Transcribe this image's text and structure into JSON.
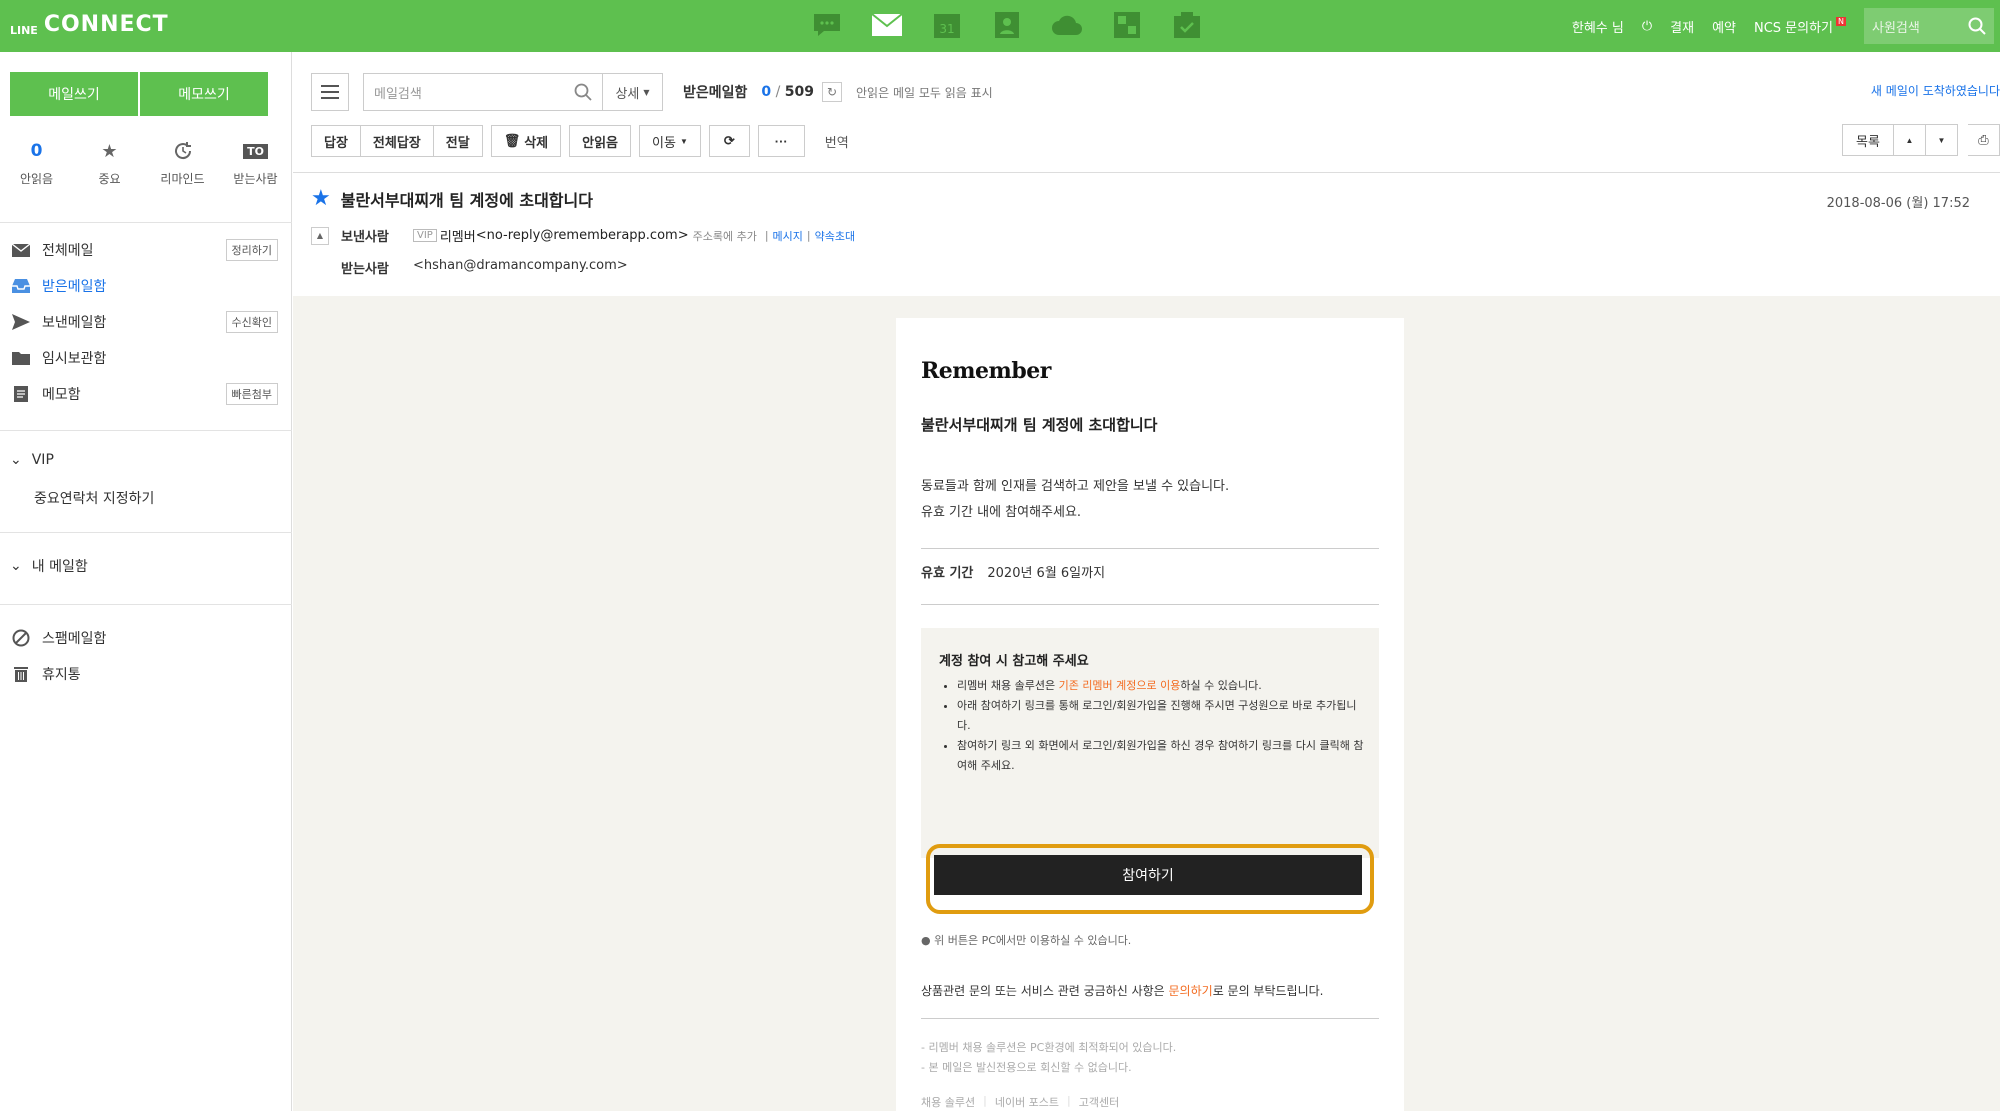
{
  "header": {
    "logo_small": "LINE",
    "logo_big": "CONNECT",
    "apps": [
      {
        "icon": "chat-icon"
      },
      {
        "icon": "mail-icon"
      },
      {
        "icon": "calendar-icon",
        "label": "31"
      },
      {
        "icon": "contacts-icon"
      },
      {
        "icon": "cloud-icon"
      },
      {
        "icon": "board-icon"
      },
      {
        "icon": "task-icon"
      }
    ],
    "user": "한혜수 님",
    "links": [
      "결재",
      "예약",
      "NCS 문의하기"
    ],
    "new_badge": "N",
    "employee_search_placeholder": "사원검색"
  },
  "sidebar": {
    "write_mail": "메일쓰기",
    "write_memo": "메모쓰기",
    "quick": [
      {
        "label": "안읽음",
        "count": "0"
      },
      {
        "label": "중요",
        "icon": "star-icon"
      },
      {
        "label": "리마인드",
        "icon": "remind-icon"
      },
      {
        "label": "받는사람",
        "badge": "TO"
      }
    ],
    "folders": [
      {
        "label": "전체메일",
        "button": "정리하기"
      },
      {
        "label": "받은메일함"
      },
      {
        "label": "보낸메일함",
        "button": "수신확인"
      },
      {
        "label": "임시보관함"
      },
      {
        "label": "메모함",
        "button": "빠른첨부"
      }
    ],
    "vip_label": "VIP",
    "vip_sub": "중요연락처 지정하기",
    "my_mailbox": "내 메일함",
    "spam": "스팸메일함",
    "trash": "휴지통"
  },
  "toolbar": {
    "search_placeholder": "메일검색",
    "detail": "상세",
    "inbox_title": "받은메일함",
    "unread": "0",
    "total": "509",
    "mark_all_read": "안읽은 메일 모두 읽음 표시",
    "new_mail_notice": "새 메일이 도착하였습니다",
    "reply": "답장",
    "reply_all": "전체답장",
    "forward": "전달",
    "delete": "삭제",
    "mark_unread": "안읽음",
    "move": "이동",
    "more": "···",
    "translate": "번역",
    "list": "목록"
  },
  "mail": {
    "subject": "불란서부대찌개 팀 계정에 초대합니다",
    "date": "2018-08-06 (월) 17:52",
    "from_label": "보낸사람",
    "vip_tag": "VIP",
    "from_name": "리멤버",
    "from_email": "<no-reply@rememberapp.com>",
    "add_contact": "주소록에 추가",
    "message": "메시지",
    "invite": "약속초대",
    "to_label": "받는사람",
    "to_email": "<hshan@dramancompany.com>"
  },
  "content": {
    "brand": "Remember",
    "title": "불란서부대찌개 팀 계정에 초대합니다",
    "desc1": "동료들과 함께 인재를 검색하고 제안을 보낼 수 있습니다.",
    "desc2": "유효 기간 내에 참여해주세요.",
    "period_label": "유효 기간",
    "period_value": "2020년 6월 6일까지",
    "note_title": "계정 참여 시 참고해 주세요",
    "note1_a": "리멤버 채용 솔루션은 ",
    "note1_b": "기존 리멤버 계정으로 이용",
    "note1_c": "하실 수 있습니다.",
    "note2": "아래 참여하기 링크를 통해 로그인/회원가입을 진행해 주시면 구성원으로 바로 추가됩니다.",
    "note3": "참여하기 링크 외 화면에서 로그인/회원가입을 하신 경우 참여하기 링크를 다시 클릭해 참여해 주세요.",
    "join_button": "참여하기",
    "pc_note": "● 위 버튼은 PC에서만 이용하실 수 있습니다.",
    "contact_a": "상품관련 문의 또는 서비스 관련 궁금하신 사항은 ",
    "contact_b": "문의하기",
    "contact_c": "로 문의 부탁드립니다.",
    "footer1": "- 리멤버 채용 솔루션은 PC환경에 최적화되어 있습니다.",
    "footer2": "- 본 메일은 발신전용으로 회신할 수 없습니다.",
    "footer_links": [
      "채용 솔루션",
      "네이버 포스트",
      "고객센터"
    ]
  },
  "colors": {
    "brand_green": "#5ec04f",
    "accent_blue": "#1a73e8",
    "highlight": "#e09c10",
    "orange": "#f36c21"
  }
}
